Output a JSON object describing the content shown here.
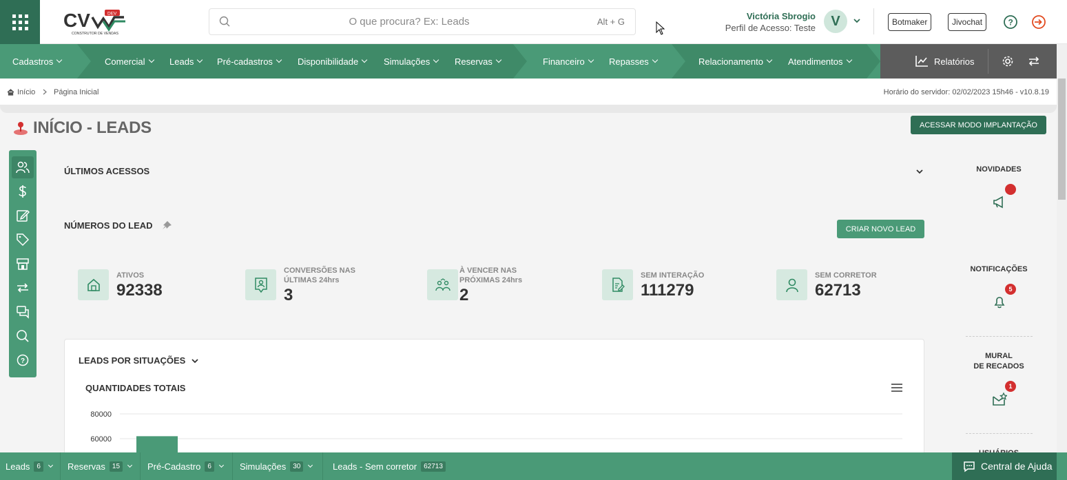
{
  "header": {
    "logo_text": "CV",
    "logo_subtitle": "CONSTRUTOR DE VENDAS",
    "logo_badge": "DEV",
    "search_placeholder": "O que procura? Ex: Leads",
    "search_shortcut": "Alt + G",
    "user_name": "Victória Sbrogio",
    "user_profile": "Perfil de Acesso: Teste",
    "avatar_initial": "V",
    "botmaker_label": "Botmaker",
    "jivochat_label": "Jivochat"
  },
  "nav": {
    "items": [
      {
        "label": "Cadastros"
      },
      {
        "label": "Comercial"
      },
      {
        "label": "Leads"
      },
      {
        "label": "Pré-cadastros"
      },
      {
        "label": "Disponibilidade"
      },
      {
        "label": "Simulações"
      },
      {
        "label": "Reservas"
      },
      {
        "label": "Financeiro"
      },
      {
        "label": "Repasses"
      },
      {
        "label": "Relacionamento"
      },
      {
        "label": "Atendimentos"
      }
    ],
    "reports_label": "Relatórios",
    "colors": {
      "nav_green": "#4a9a77",
      "dark_green": "#2f6e55",
      "gray": "#5c5c5c"
    }
  },
  "breadcrumb": {
    "home": "Início",
    "current": "Página Inicial",
    "server_time": "Horário do servidor: 02/02/2023 15h46 - v10.8.19"
  },
  "page": {
    "title": "INÍCIO - LEADS",
    "implant_button": "ACESSAR MODO IMPLANTAÇÃO",
    "recent_access_title": "ÚLTIMOS ACESSOS",
    "lead_numbers_title": "NÚMEROS DO LEAD",
    "new_lead_button": "CRIAR NOVO LEAD"
  },
  "stats": [
    {
      "label": "ATIVOS",
      "value": "92338",
      "icon": "house-icon"
    },
    {
      "label": "CONVERSÕES NAS ÚLTIMAS 24hrs",
      "value": "3",
      "icon": "user-badge-icon"
    },
    {
      "label": "À VENCER NAS PRÓXIMAS 24hrs",
      "value": "2",
      "icon": "users-clock-icon"
    },
    {
      "label": "SEM INTERAÇÃO",
      "value": "111279",
      "icon": "document-edit-icon"
    },
    {
      "label": "SEM CORRETOR",
      "value": "62713",
      "icon": "person-icon"
    }
  ],
  "chart_section": {
    "header": "LEADS POR SITUAÇÕES",
    "title": "QUANTIDADES TOTAIS"
  },
  "chart_data": {
    "type": "bar",
    "title": "QUANTIDADES TOTAIS",
    "ytick_labels": [
      "80000",
      "60000"
    ],
    "ylim": [
      0,
      80000
    ],
    "values": [
      62000
    ],
    "grid": true
  },
  "right_panel": {
    "news_label": "NOVIDADES",
    "notifications_label": "NOTIFICAÇÕES",
    "notifications_count": "5",
    "board_label_line1": "MURAL",
    "board_label_line2": "DE RECADOS",
    "board_count": "1",
    "users_label": "USUÁRIOS"
  },
  "footer": {
    "tabs": [
      {
        "label": "Leads",
        "count": "6"
      },
      {
        "label": "Reservas",
        "count": "15"
      },
      {
        "label": "Pré-Cadastro",
        "count": "6"
      },
      {
        "label": "Simulações",
        "count": "30"
      },
      {
        "label": "Leads - Sem corretor",
        "count": "62713"
      }
    ],
    "help_center": "Central de Ajuda"
  }
}
